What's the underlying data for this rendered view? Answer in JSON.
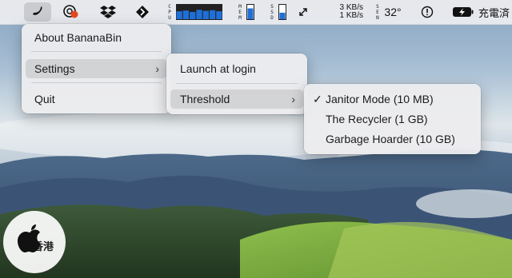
{
  "colors": {
    "menubar_bg": "#eeeef0",
    "menu_bg": "#ececee",
    "highlight": "rgba(0,0,0,0.10)",
    "notification_dot": "#e8461e",
    "cpu_meter": "#1f6fd6",
    "mem_meter": "#1f6fd6"
  },
  "menubar": {
    "icons": [
      "banana-icon",
      "app-with-red-dot-icon",
      "dropbox-icon",
      "shortcut-arrow-icon",
      "cpu-meter",
      "memory-meter",
      "ssd-meter",
      "arrows-icon",
      "sensor-icon",
      "clock-warning-icon",
      "battery-icon"
    ],
    "cpu_label": "CPU",
    "mem_label": "MEM",
    "ssd_label": "SSD",
    "sen_label": "SEN",
    "net_up": "3 KB/s",
    "net_down": "1 KB/s",
    "temperature": "32°",
    "input_method": "充電済"
  },
  "meters": {
    "cpu_levels": [
      0.55,
      0.6,
      0.5,
      0.65,
      0.58,
      0.62,
      0.55
    ],
    "mem_level": 0.75,
    "ssd_level": 0.45
  },
  "menus": {
    "app": {
      "about": "About BananaBin",
      "settings": "Settings",
      "quit": "Quit"
    },
    "settings": {
      "launch_at_login": "Launch at login",
      "threshold": "Threshold"
    },
    "threshold": {
      "options": [
        {
          "label": "Janitor Mode (10 MB)",
          "checked": true
        },
        {
          "label": "The Recycler (1 GB)",
          "checked": false
        },
        {
          "label": "Garbage Hoarder (10 GB)",
          "checked": false
        }
      ],
      "check_mark": "✓"
    },
    "chevron": "›"
  },
  "watermark": {
    "text": "香港"
  }
}
